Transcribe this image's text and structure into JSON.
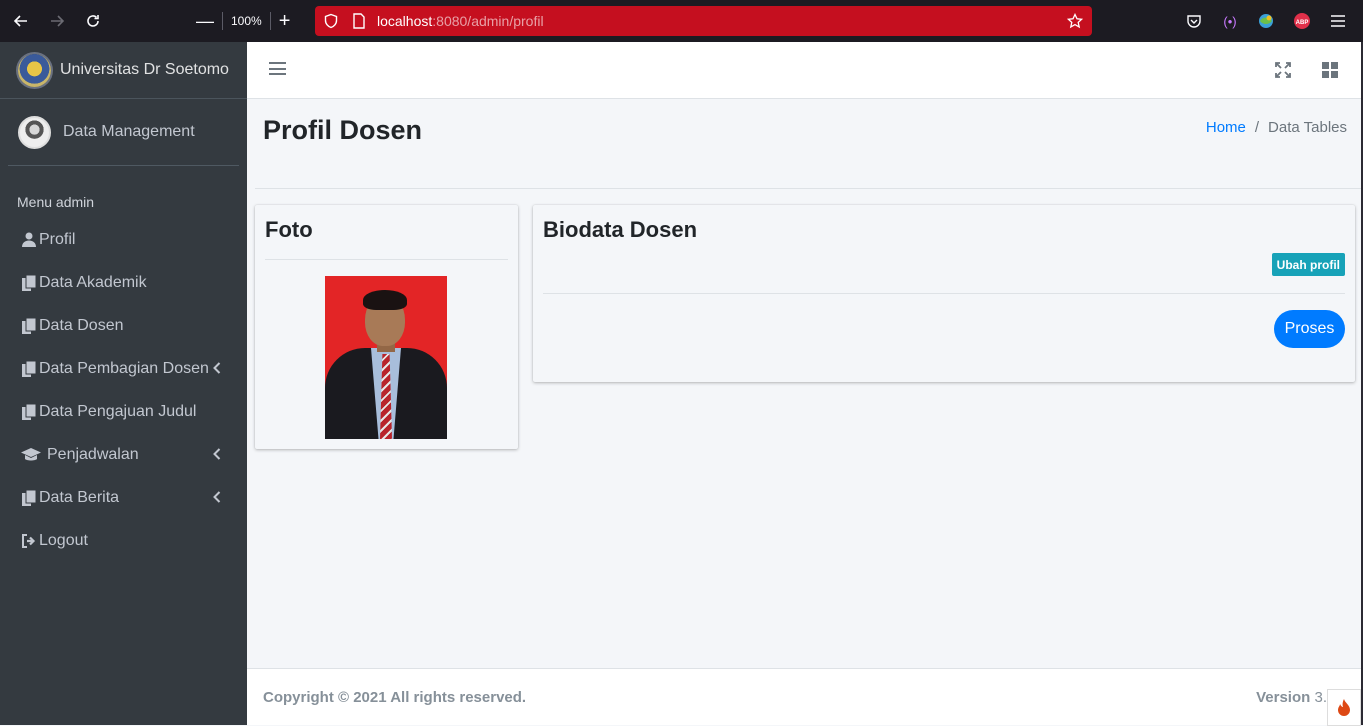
{
  "browser": {
    "zoom": "100%",
    "url_host": "localhost",
    "url_rest": ":8080/admin/profil"
  },
  "sidebar": {
    "brand": "Universitas Dr Soetomo",
    "user": "Data Management",
    "menu_header": "Menu admin",
    "items": [
      {
        "label": "Profil",
        "icon": "user-icon",
        "has_children": false
      },
      {
        "label": "Data Akademik",
        "icon": "copy-icon",
        "has_children": false
      },
      {
        "label": "Data Dosen",
        "icon": "copy-icon",
        "has_children": false
      },
      {
        "label": "Data Pembagian Dosen",
        "icon": "copy-icon",
        "has_children": true
      },
      {
        "label": "Data Pengajuan Judul",
        "icon": "copy-icon",
        "has_children": false
      },
      {
        "label": "Penjadwalan",
        "icon": "graduation-cap-icon",
        "has_children": true
      },
      {
        "label": "Data Berita",
        "icon": "copy-icon",
        "has_children": true
      },
      {
        "label": "Logout",
        "icon": "sign-out-icon",
        "has_children": false
      }
    ]
  },
  "page": {
    "title": "Profil Dosen",
    "breadcrumb": {
      "home": "Home",
      "divider": "/",
      "current": "Data Tables"
    }
  },
  "photo_card": {
    "title": "Foto"
  },
  "biodata_card": {
    "title": "Biodata Dosen",
    "edit_label": "Ubah profil",
    "submit_label": "Proses"
  },
  "footer": {
    "copyright": "Copyright © 2021 All rights reserved.",
    "version_label": "Version",
    "version_value": "3."
  },
  "colors": {
    "sidebar_bg": "#343a40",
    "primary": "#007bff",
    "info": "#17a2b8",
    "url_bar": "#c50f1f"
  }
}
